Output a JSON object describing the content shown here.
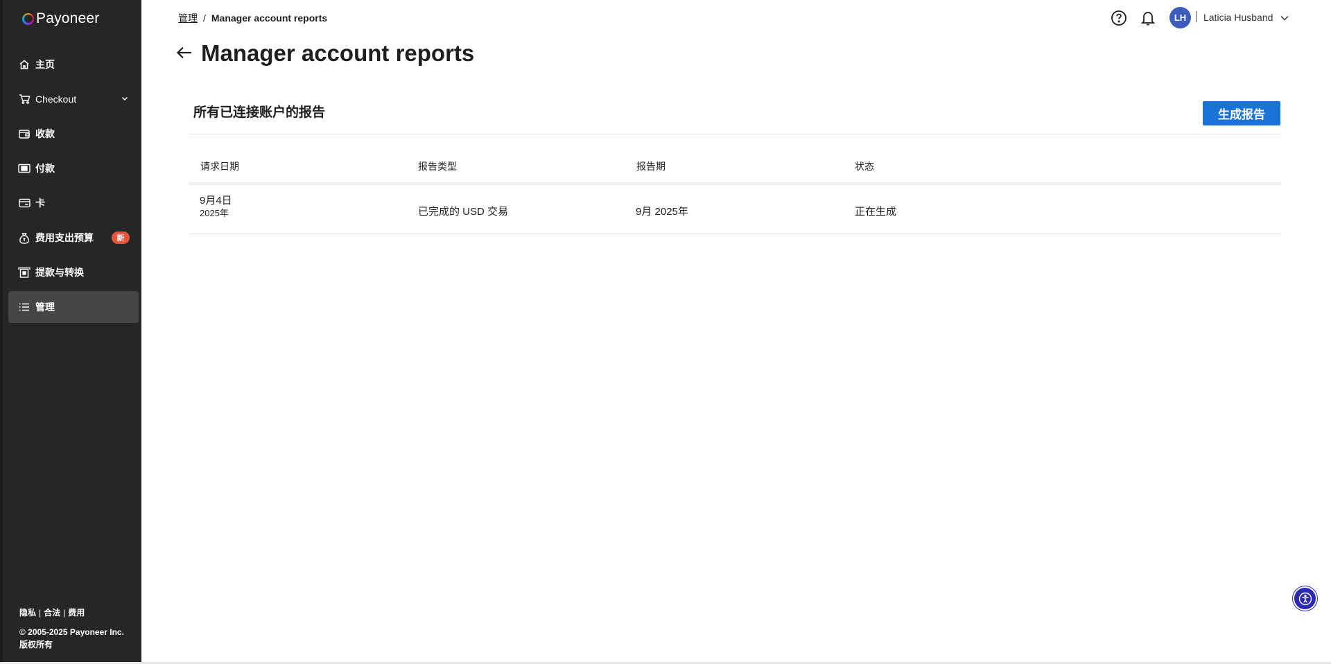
{
  "brand": {
    "name": "Payoneer"
  },
  "sidebar": {
    "items": [
      {
        "label": "主页",
        "icon": "home-icon"
      },
      {
        "label": "Checkout",
        "icon": "cart-icon"
      },
      {
        "label": "收款",
        "icon": "wallet-icon"
      },
      {
        "label": "付款",
        "icon": "banknote-icon"
      },
      {
        "label": "卡",
        "icon": "card-icon"
      },
      {
        "label": "费用支出预算",
        "icon": "moneybag-icon",
        "badge": "新"
      },
      {
        "label": "提款与转换",
        "icon": "withdraw-icon"
      },
      {
        "label": "管理",
        "icon": "list-icon",
        "active": true
      }
    ],
    "footer": {
      "links": [
        "隐私",
        "合法",
        "费用"
      ],
      "copyright_line1": "© 2005-2025 Payoneer Inc.",
      "copyright_line2": "版权所有"
    }
  },
  "header": {
    "breadcrumb": {
      "parent": "管理",
      "current": "Manager account reports"
    },
    "title": "Manager account reports",
    "user": {
      "initials": "LH",
      "name": "Laticia Husband"
    }
  },
  "section": {
    "title": "所有已连接账户的报告",
    "generate_button": "生成报告"
  },
  "table": {
    "columns": [
      "请求日期",
      "报告类型",
      "报告期",
      "状态"
    ],
    "rows": [
      {
        "date_line1": "9月4日",
        "date_line2": "2025年",
        "type": "已完成的 USD 交易",
        "period": "9月 2025年",
        "status": "正在生成"
      }
    ]
  },
  "colors": {
    "sidebar_bg": "#262626",
    "active_item_bg": "#454545",
    "primary_button": "#1a73d6",
    "badge": "#e5553b",
    "avatar": "#3b5bbd"
  }
}
